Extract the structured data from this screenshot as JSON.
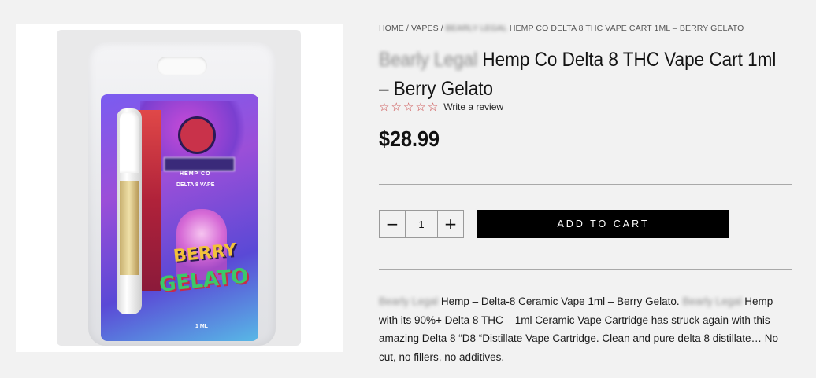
{
  "breadcrumb": {
    "home": "HOME",
    "sep1": " / ",
    "vapes": "VAPES",
    "sep2": " / ",
    "brand_blurred": "BEARLY LEGAL",
    "current": " HEMP CO DELTA 8 THC VAPE CART 1ML – BERRY GELATO"
  },
  "product": {
    "brand_blurred": "Bearly Legal",
    "title_rest": " Hemp Co Delta 8 THC Vape Cart 1ml – Berry Gelato",
    "rating_stars": 0,
    "rating_max": 5,
    "review_link": "Write a review",
    "price": "$28.99"
  },
  "purchase": {
    "minus_symbol": "−",
    "plus_symbol": "+",
    "quantity": "1",
    "add_to_cart_label": "ADD TO CART"
  },
  "description": {
    "part1_blurred": "Bearly Legal",
    "part2": " Hemp – Delta-8 Ceramic Vape 1ml – Berry Gelato. ",
    "part3_blurred": "Bearly Legal",
    "part4": " Hemp with its 90%+ Delta 8 THC – 1ml Ceramic Vape Cartridge has struck again with this amazing Delta 8 “D8 “Distillate Vape Cartridge. Clean and pure delta 8 distillate… No cut, no fillers, no additives."
  },
  "image": {
    "icon": "product-photo",
    "package_hemp_co": "HEMP CO",
    "package_delta": "DELTA 8 VAPE",
    "package_berry": "BERRY",
    "package_gelato": "GELATO",
    "package_size": "1 ML"
  },
  "colors": {
    "star_outline": "#cc4b4b",
    "button_bg": "#000000",
    "page_bg": "#f2f2f2"
  }
}
